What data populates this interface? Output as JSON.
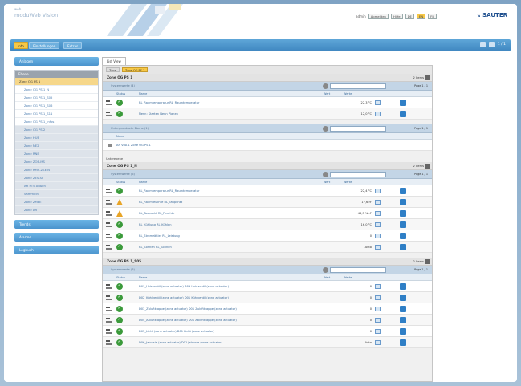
{
  "header": {
    "logo_top": "web",
    "logo_text": "moduWeb Vision",
    "links": [
      {
        "label": "admin",
        "box": false
      },
      {
        "label": "Abmelden",
        "box": true
      },
      {
        "label": "Hilfe",
        "box": true
      },
      {
        "label": "DE",
        "box": true
      },
      {
        "label": "EN",
        "box": true,
        "highlight": true
      },
      {
        "label": "FR",
        "box": true
      }
    ],
    "brand": "SAUTER",
    "accent": "#f7c846",
    "brand_color": "#1e4f8e"
  },
  "tabbar": {
    "tabs": [
      {
        "label": "Info",
        "active": true
      },
      {
        "label": "Einstellungen",
        "active": false
      },
      {
        "label": "Extras",
        "active": false
      }
    ],
    "right_label": "1 / 1",
    "bar_color": "#4a93cd"
  },
  "sidebar": {
    "top_button": "Anlagen",
    "tree_header": "Ebene",
    "items": [
      {
        "label": "Zone OG PS 1",
        "type": "sel"
      },
      {
        "label": "Zone OG PS 1_N",
        "type": "sub"
      },
      {
        "label": "Zone OG PS 1_S05",
        "type": "sub"
      },
      {
        "label": "Zone OG PS 1_S06",
        "type": "sub"
      },
      {
        "label": "Zone OG PS 1_S11",
        "type": "sub"
      },
      {
        "label": "Zone OG PS 1_Infos",
        "type": "sub"
      },
      {
        "label": "Zone OG PS 2",
        "type": "grp"
      },
      {
        "label": "Zone HUB",
        "type": "grp"
      },
      {
        "label": "Zone NE2",
        "type": "grp"
      },
      {
        "label": "Zone RNE",
        "type": "grp"
      },
      {
        "label": "Zone ZOE-MS",
        "type": "grp"
      },
      {
        "label": "Zone RMS-ZSE N",
        "type": "grp"
      },
      {
        "label": "Zone ZES-SF",
        "type": "grp"
      },
      {
        "label": "AR RTS Außen",
        "type": "grp"
      },
      {
        "label": "Sammeln",
        "type": "grp"
      },
      {
        "label": "Zone ZMEE",
        "type": "grp"
      },
      {
        "label": "Zone AR",
        "type": "grp"
      }
    ],
    "bottom_buttons": [
      "Trends",
      "Alarme",
      "Logbuch"
    ]
  },
  "main": {
    "tab_label": "List View",
    "crumbs": [
      "Zone",
      "Zone OG PS 1"
    ],
    "sections": [
      {
        "title": "Zone OG PS 1",
        "right_label": "2 Items",
        "toolbar_label": "Systemwerte (4)",
        "page_label": "Page 1 / 1",
        "columns": [
          "Status",
          "Name",
          "Wert",
          "Werte"
        ],
        "rows": [
          {
            "name": "RL_Raumtemperatur RL_Raumtemperatur",
            "value": "22,3 °C",
            "status": "ok"
          },
          {
            "name": "Nenn: Starten Nenn Planen",
            "value": "12,0 °C",
            "status": "ok"
          }
        ]
      },
      {
        "title": "",
        "right_label": "",
        "toolbar_label": "Untergeordnete Ebene (1)",
        "page_label": "Page 1 / 1",
        "columns": [
          "Name"
        ],
        "rows": [
          {
            "name": "AR VRA 1 Zone OG PS 1",
            "value": "",
            "status": "none"
          }
        ]
      },
      {
        "label_above": "Unterebene",
        "title": "Zone OG PS 1_N",
        "right_label": "2 Items",
        "toolbar_label": "Systemwerte (6)",
        "page_label": "Page 1 / 1",
        "columns": [
          "Status",
          "Name",
          "Wert",
          "Werte"
        ],
        "rows": [
          {
            "name": "RL_Raumtemperatur RL_Raumtemperatur",
            "value": "22,4 °C",
            "status": "ok"
          },
          {
            "name": "RL_Raumfeuchte RL_Taupunkt",
            "value": "17,6 rF",
            "status": "warn"
          },
          {
            "name": "RL_Taupunkt RL_Feuchte",
            "value": "43,5 % rF",
            "status": "warn"
          },
          {
            "name": "RL_Kühlung RL_Kühlen",
            "value": "16,0 °C",
            "status": "ok"
          },
          {
            "name": "RL_Stromzähler RL_Leistung",
            "value": "0",
            "status": "ok"
          },
          {
            "name": "RL_Sonnen RL_Sonnen",
            "value": "Auto",
            "status": "ok"
          }
        ]
      },
      {
        "title": "Zone OG PS 1_S05",
        "right_label": "2 Items",
        "toolbar_label": "Systemwerte (6)",
        "page_label": "Page 1 / 1",
        "columns": [
          "Status",
          "Name",
          "Wert",
          "Werte"
        ],
        "rows": [
          {
            "name": "D01_Heizventil (zone actuator) D01 Heizventil (zone actuator)",
            "value": "0",
            "status": "ok"
          },
          {
            "name": "D02_Kühlventil (zone actuator) D01 Kühlventil (zone actuator)",
            "value": "0",
            "status": "ok"
          },
          {
            "name": "D03_Zuluftklappe (zone actuator) D01 Zuluftklappe (zone actuator)",
            "value": "0",
            "status": "ok"
          },
          {
            "name": "D04_Abluftklappe (zone actuator) D01 Abluftklappe (zone actuator)",
            "value": "0",
            "status": "ok"
          },
          {
            "name": "D05_Licht (zone actuator) D01 Licht (zone actuator)",
            "value": "0",
            "status": "ok"
          },
          {
            "name": "D06_Jalousie (zone actuator) D01 Jalousie (zone actuator)",
            "value": "Auto",
            "status": "ok"
          }
        ]
      }
    ]
  }
}
